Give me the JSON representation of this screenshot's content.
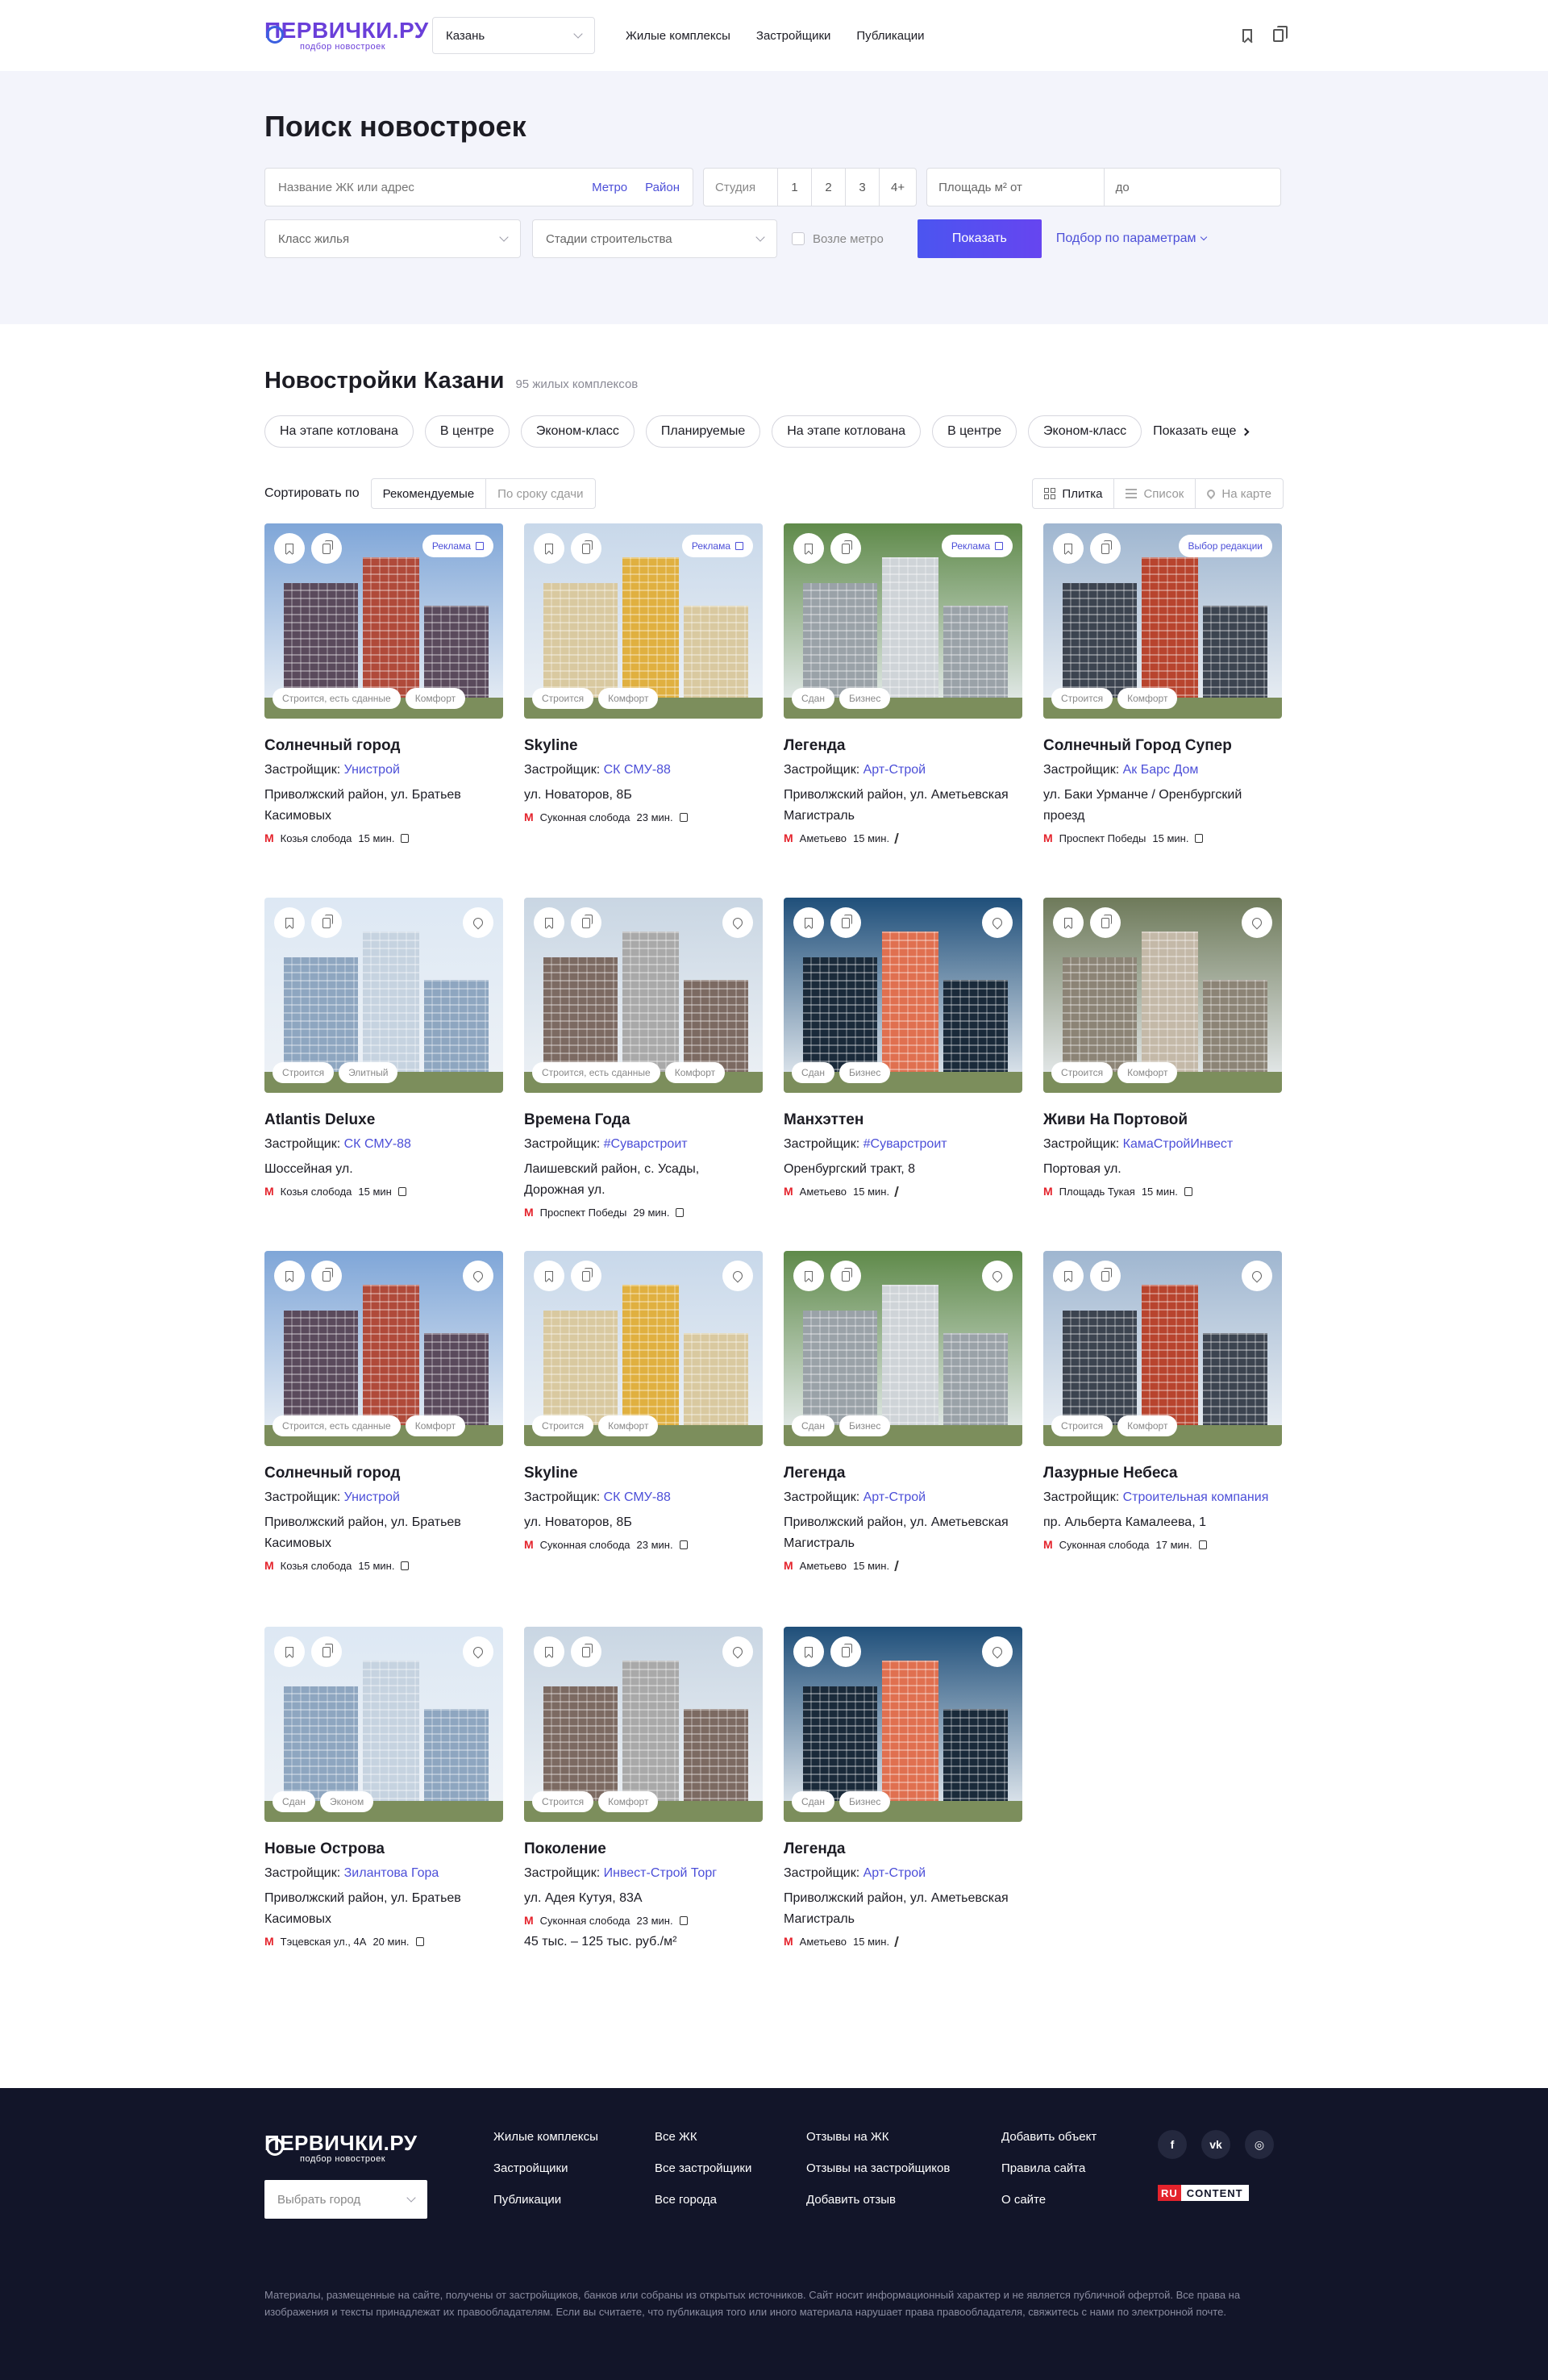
{
  "header": {
    "logo_main": "ПЕРВИЧКИ.РУ",
    "logo_sub": "подбор новостроек",
    "city": "Казань",
    "nav": [
      "Жилые комплексы",
      "Застройщики",
      "Публикации"
    ]
  },
  "search": {
    "title": "Поиск новостроек",
    "name_placeholder": "Название ЖК или адрес",
    "metro_link": "Метро",
    "district_link": "Район",
    "rooms": [
      "Студия",
      "1",
      "2",
      "3",
      "4+"
    ],
    "area_from": "Площадь м²  от",
    "area_to": "до",
    "class_placeholder": "Класс жилья",
    "stage_placeholder": "Стадии строительства",
    "near_metro": "Возле метро",
    "show_button": "Показать",
    "params_link": "Подбор по параметрам"
  },
  "listing": {
    "title": "Новостройки Казани",
    "count": "95 жилых комплексов",
    "chips": [
      "На этапе котлована",
      "В центре",
      "Эконом-класс",
      "Планируемые",
      "На этапе котлована",
      "В центре",
      "Эконом-класс"
    ],
    "show_more": "Показать еще",
    "sort_label": "Сортировать по",
    "sort_options": [
      "Рекомендуемые",
      "По сроку сдачи"
    ],
    "views": [
      "Плитка",
      "Список",
      "На карте"
    ],
    "developer_label": "Застройщик: "
  },
  "colors": {
    "accent": "#4c4fd8",
    "button": "#5050f0",
    "metro": "#e4232c",
    "footer_bg": "#121529"
  },
  "cards": [
    {
      "name": "Солнечный город",
      "developer": "Унистрой",
      "address": "Приволжский район, ул. Братьев Касимовых",
      "metro": "Козья слобода",
      "time": "15 мин.",
      "transport": "bus",
      "badges": [
        "Строится, есть сданные",
        "Комфорт"
      ],
      "ad": "Реклама",
      "pin": false,
      "price": ""
    },
    {
      "name": "Skyline",
      "developer": "СК СМУ-88",
      "address": "ул. Новаторов, 8Б",
      "metro": "Суконная слобода",
      "time": "23 мин.",
      "transport": "bus",
      "badges": [
        "Строится",
        "Комфорт"
      ],
      "ad": "Реклама",
      "pin": false,
      "price": ""
    },
    {
      "name": "Легенда",
      "developer": "Арт-Строй",
      "address": "Приволжский район, ул. Аметьевская Магистраль",
      "metro": "Аметьево",
      "time": "15 мин.",
      "transport": "walk",
      "badges": [
        "Сдан",
        "Бизнес"
      ],
      "ad": "Реклама",
      "pin": false,
      "price": ""
    },
    {
      "name": "Солнечный Город Супер",
      "developer": "Ак Барс Дом",
      "address": "ул. Баки Урманче / Оренбургский проезд",
      "metro": "Проспект Победы",
      "time": "15 мин.",
      "transport": "bus",
      "badges": [
        "Строится",
        "Комфорт"
      ],
      "ad": "Выбор редакции",
      "pin": false,
      "price": ""
    },
    {
      "name": "Atlantis Deluxe",
      "developer": "СК СМУ-88",
      "address": "Шоссейная ул.",
      "metro": "Козья слобода",
      "time": "15 мин",
      "transport": "bus",
      "badges": [
        "Строится",
        "Элитный"
      ],
      "ad": "",
      "pin": true,
      "price": ""
    },
    {
      "name": "Времена Года",
      "developer": "#Суварстроит",
      "address": "Лаишевский район, с. Усады, Дорожная ул.",
      "metro": "Проспект Победы",
      "time": "29 мин.",
      "transport": "bus",
      "badges": [
        "Строится, есть сданные",
        "Комфорт"
      ],
      "ad": "",
      "pin": true,
      "price": ""
    },
    {
      "name": "Манхэттен",
      "developer": "#Суварстроит",
      "address": "Оренбургский тракт, 8",
      "metro": "Аметьево",
      "time": "15 мин.",
      "transport": "walk",
      "badges": [
        "Сдан",
        "Бизнес"
      ],
      "ad": "",
      "pin": true,
      "price": ""
    },
    {
      "name": "Живи На Портовой",
      "developer": "КамаСтройИнвест",
      "address": "Портовая ул.",
      "metro": "Площадь Тукая",
      "time": "15 мин.",
      "transport": "bus",
      "badges": [
        "Строится",
        "Комфорт"
      ],
      "ad": "",
      "pin": true,
      "price": ""
    },
    {
      "name": "Солнечный город",
      "developer": "Унистрой",
      "address": "Приволжский район, ул. Братьев Касимовых",
      "metro": "Козья слобода",
      "time": "15 мин.",
      "transport": "bus",
      "badges": [
        "Строится, есть сданные",
        "Комфорт"
      ],
      "ad": "",
      "pin": true,
      "price": ""
    },
    {
      "name": "Skyline",
      "developer": "СК СМУ-88",
      "address": "ул. Новаторов, 8Б",
      "metro": "Суконная слобода",
      "time": "23 мин.",
      "transport": "bus",
      "badges": [
        "Строится",
        "Комфорт"
      ],
      "ad": "",
      "pin": true,
      "price": ""
    },
    {
      "name": "Легенда",
      "developer": "Арт-Строй",
      "address": "Приволжский район, ул. Аметьевская Магистраль",
      "metro": "Аметьево",
      "time": "15 мин.",
      "transport": "walk",
      "badges": [
        "Сдан",
        "Бизнес"
      ],
      "ad": "",
      "pin": true,
      "price": ""
    },
    {
      "name": "Лазурные Небеса",
      "developer": "Строительная компания",
      "address": "пр. Альберта Камалеева, 1",
      "metro": "Суконная слобода",
      "time": "17 мин.",
      "transport": "bus",
      "badges": [
        "Строится",
        "Комфорт"
      ],
      "ad": "",
      "pin": true,
      "price": ""
    },
    {
      "name": "Новые Острова",
      "developer": "Зилантова Гора",
      "address": "Приволжский район, ул. Братьев Касимовых",
      "metro": "Тэцевская ул., 4А",
      "time": "20 мин.",
      "transport": "bus",
      "badges": [
        "Сдан",
        "Эконом"
      ],
      "ad": "",
      "pin": true,
      "price": ""
    },
    {
      "name": "Поколение",
      "developer": "Инвест-Строй Торг",
      "address": "ул. Адея Кутуя, 83А",
      "metro": "Суконная слобода",
      "time": "23 мин.",
      "transport": "bus",
      "badges": [
        "Строится",
        "Комфорт"
      ],
      "ad": "",
      "pin": true,
      "price": "45 тыс. – 125 тыс. руб./м²"
    },
    {
      "name": "Легенда",
      "developer": "Арт-Строй",
      "address": "Приволжский район, ул. Аметьевская Магистраль",
      "metro": "Аметьево",
      "time": "15 мин.",
      "transport": "walk",
      "badges": [
        "Сдан",
        "Бизнес"
      ],
      "ad": "",
      "pin": true,
      "price": ""
    }
  ],
  "footer": {
    "logo_main": "ПЕРВИЧКИ.РУ",
    "logo_sub": "подбор новостроек",
    "city_placeholder": "Выбрать город",
    "col1": [
      "Жилые комплексы",
      "Застройщики",
      "Публикации"
    ],
    "col2": [
      "Все ЖК",
      "Все застройщики",
      "Все города"
    ],
    "col3": [
      "Отзывы на ЖК",
      "Отзывы на застройщиков",
      "Добавить отзыв"
    ],
    "col4": [
      "Добавить объект",
      "Правила сайта",
      "О сайте"
    ],
    "social": [
      "f",
      "vk",
      "ig"
    ],
    "rc_ru": "RU",
    "rc_content": "CONTENT",
    "note": "Материалы, размещенные на сайте, получены от застройщиков, банков или собраны из открытых источников. Сайт носит информационный характер и не является публичной офертой. Все права на изображения и тексты принадлежат их правообладателям. Если вы считаете, что публикация того или иного материала нарушает права правообладателя, свяжитесь с нами по электронной почте."
  }
}
